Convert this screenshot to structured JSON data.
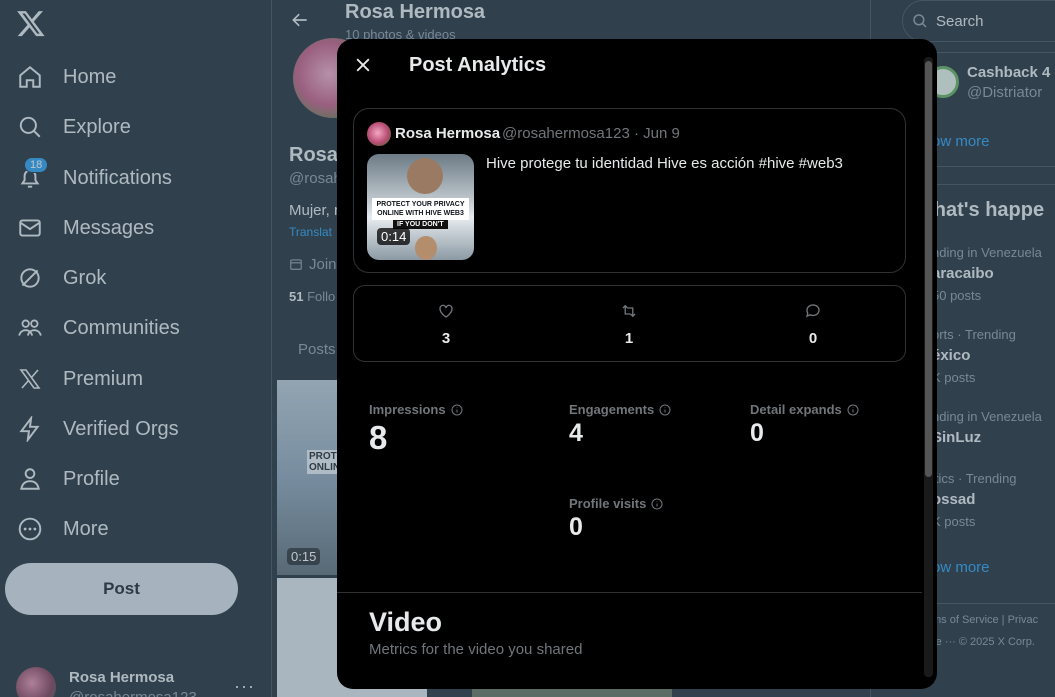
{
  "nav": {
    "items": [
      {
        "label": "Home",
        "icon": "home-icon"
      },
      {
        "label": "Explore",
        "icon": "search-icon"
      },
      {
        "label": "Notifications",
        "icon": "bell-icon",
        "badge": "18"
      },
      {
        "label": "Messages",
        "icon": "mail-icon"
      },
      {
        "label": "Grok",
        "icon": "grok-icon"
      },
      {
        "label": "Communities",
        "icon": "people-icon"
      },
      {
        "label": "Premium",
        "icon": "x-logo-icon"
      },
      {
        "label": "Verified Orgs",
        "icon": "lightning-icon"
      },
      {
        "label": "Profile",
        "icon": "person-icon"
      },
      {
        "label": "More",
        "icon": "more-circle-icon"
      }
    ],
    "post_label": "Post",
    "account": {
      "name": "Rosa Hermosa",
      "handle": "@rosahermosa123",
      "menu": "···"
    }
  },
  "profile": {
    "header_name": "Rosa Hermosa",
    "header_sub": "10 photos & videos",
    "name_partial": "Rosa",
    "handle_partial": "@rosah",
    "bio_partial": "Mujer, r",
    "translate_partial": "Translat",
    "joined_partial": "Join",
    "followers_count": "51",
    "followers_partial": "Follo",
    "tab": "Posts",
    "grid_overlay_text": "PROT\nONLIN",
    "grid_duration": "0:15"
  },
  "right": {
    "search_placeholder": "Search",
    "who_to_follow": {
      "name": "Cashback 4",
      "handle": "@Distriator"
    },
    "show_more": "ow more",
    "whats_happening": "'hat's happe",
    "trends": [
      {
        "context": "nding in Venezuela",
        "name": "aracaibo",
        "posts": "50 posts"
      },
      {
        "context": "orts · Trending",
        "name": "éxico",
        "posts": "K posts"
      },
      {
        "context": "nding in Venezuela",
        "name": "SinLuz",
        "posts": ""
      },
      {
        "context": "itics · Trending",
        "name": "ossad",
        "posts": "K posts"
      }
    ],
    "show_more_2": "ow more",
    "footer_1": "ms of Service  |   Privac",
    "footer_2": "re ···     © 2025 X Corp."
  },
  "modal": {
    "title": "Post Analytics",
    "post": {
      "author": "Rosa Hermosa",
      "handle_date": "@rosahermosa123 · Jun 9",
      "text": "Hive protege tu identidad Hive es acción #hive #web3",
      "thumb_text": "PROTECT YOUR PRIVACY ONLINE WITH HIVE WEB3",
      "thumb_text_2": "IF YOU DON'T",
      "duration": "0:14"
    },
    "stats": [
      {
        "icon": "heart-icon",
        "value": "3"
      },
      {
        "icon": "repost-icon",
        "value": "1"
      },
      {
        "icon": "reply-icon",
        "value": "0"
      }
    ],
    "metrics": {
      "impressions": {
        "label": "Impressions",
        "value": "8"
      },
      "engagements": {
        "label": "Engagements",
        "value": "4"
      },
      "detail_expands": {
        "label": "Detail expands",
        "value": "0"
      },
      "profile_visits": {
        "label": "Profile visits",
        "value": "0"
      }
    },
    "video": {
      "title": "Video",
      "subtitle": "Metrics for the video you shared"
    }
  },
  "colors": {
    "accent": "#1d9bf0",
    "background": "#15202b",
    "modal": "#000000"
  }
}
